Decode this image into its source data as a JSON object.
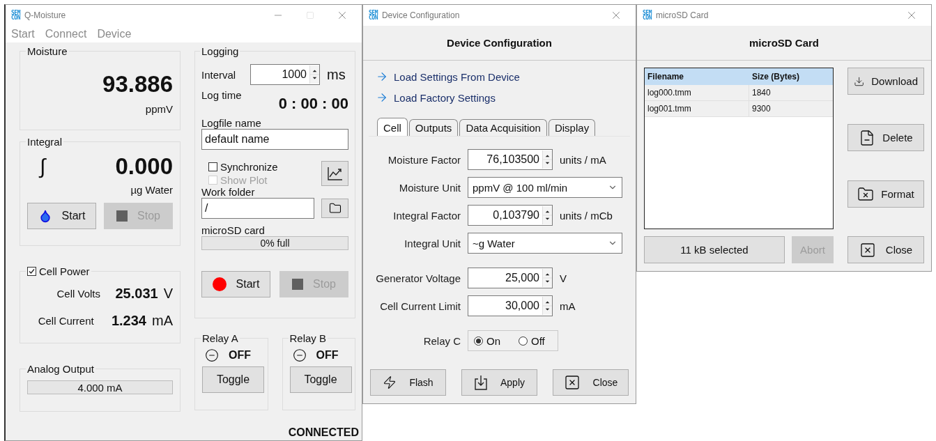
{
  "main_window": {
    "logo": [
      "SEM",
      "CON"
    ],
    "title": "Q-Moisture",
    "menu": [
      "Start",
      "Connect",
      "Device"
    ],
    "moisture": {
      "title": "Moisture",
      "value": "93.886",
      "unit": "ppmV"
    },
    "integral": {
      "title": "Integral",
      "symbol": "∫",
      "value": "0.000",
      "unit": "µg Water",
      "start": {
        "label": "Start",
        "disabled": false
      },
      "stop": {
        "label": "Stop",
        "disabled": true
      }
    },
    "cell_power": {
      "label": "Cell Power",
      "checked": true,
      "rows": [
        {
          "label": "Cell Volts",
          "value": "25.031",
          "unit": "V"
        },
        {
          "label": "Cell Current",
          "value": "1.234",
          "unit": "mA"
        }
      ]
    },
    "analog_output": {
      "title": "Analog Output",
      "reading": "4.000 mA"
    },
    "logging": {
      "title": "Logging",
      "interval_label": "Interval",
      "interval_value": "1000",
      "interval_unit": "ms",
      "log_time_label": "Log time",
      "log_time": "0 : 00 : 00",
      "logfile_label": "Logfile name",
      "logfile_value": "default name",
      "options": [
        {
          "label": "Synchronize",
          "checked": false,
          "disabled": false
        },
        {
          "label": "Show Plot",
          "checked": false,
          "disabled": true
        }
      ],
      "work_folder_label": "Work folder",
      "work_folder_value": "/",
      "sd_label": "microSD card",
      "sd_bar": {
        "level": 0,
        "reading": "0% full"
      },
      "start": {
        "label": "Start",
        "disabled": false
      },
      "stop": {
        "label": "Stop",
        "disabled": true
      }
    },
    "relays": [
      {
        "title": "Relay A",
        "state": "OFF",
        "button": "Toggle"
      },
      {
        "title": "Relay B",
        "state": "OFF",
        "button": "Toggle"
      }
    ],
    "status": "CONNECTED"
  },
  "config_window": {
    "logo": [
      "SEM",
      "CON"
    ],
    "title": "Device Configuration",
    "heading": "Device Configuration",
    "links": [
      "Load Settings From Device",
      "Load Factory Settings"
    ],
    "tabs": [
      {
        "label": "Cell",
        "selected": true
      },
      {
        "label": "Outputs",
        "selected": false
      },
      {
        "label": "Data Acquisition",
        "selected": false
      },
      {
        "label": "Display",
        "selected": false
      }
    ],
    "fields": [
      {
        "kind": "spin",
        "label": "Moisture Factor",
        "value": "76,103500",
        "unit": "units / mA"
      },
      {
        "kind": "select",
        "label": "Moisture Unit",
        "value": "ppmV @ 100 ml/min"
      },
      {
        "kind": "spin",
        "label": "Integral Factor",
        "value": "0,103790",
        "unit": "units / mCb"
      },
      {
        "kind": "select",
        "label": "Integral Unit",
        "value": "~g Water"
      },
      {
        "kind": "spin",
        "label": "Generator Voltage",
        "value": "25,000",
        "unit": "V"
      },
      {
        "kind": "spin",
        "label": "Cell Current Limit",
        "value": "30,000",
        "unit": "mA"
      }
    ],
    "relay_c": {
      "label": "Relay C",
      "options": [
        {
          "label": "On",
          "selected": true
        },
        {
          "label": "Off",
          "selected": false
        }
      ]
    },
    "buttons": [
      {
        "kind": "flash",
        "label": "Flash"
      },
      {
        "kind": "apply",
        "label": "Apply"
      },
      {
        "kind": "close",
        "label": "Close"
      }
    ]
  },
  "sd_window": {
    "logo": [
      "SEM",
      "CON"
    ],
    "title": "microSD Card",
    "heading": "microSD Card",
    "columns": [
      "Filename",
      "Size (Bytes)"
    ],
    "rows": [
      [
        "log000.tmm",
        "1840"
      ],
      [
        "log001.tmm",
        "9300"
      ]
    ],
    "side_buttons": [
      {
        "kind": "download",
        "label": "Download"
      },
      {
        "kind": "delete",
        "label": "Delete"
      },
      {
        "kind": "format",
        "label": "Format"
      }
    ],
    "selection": "11 kB selected",
    "abort": {
      "label": "Abort",
      "disabled": true
    },
    "close": {
      "kind": "close",
      "label": "Close"
    }
  }
}
